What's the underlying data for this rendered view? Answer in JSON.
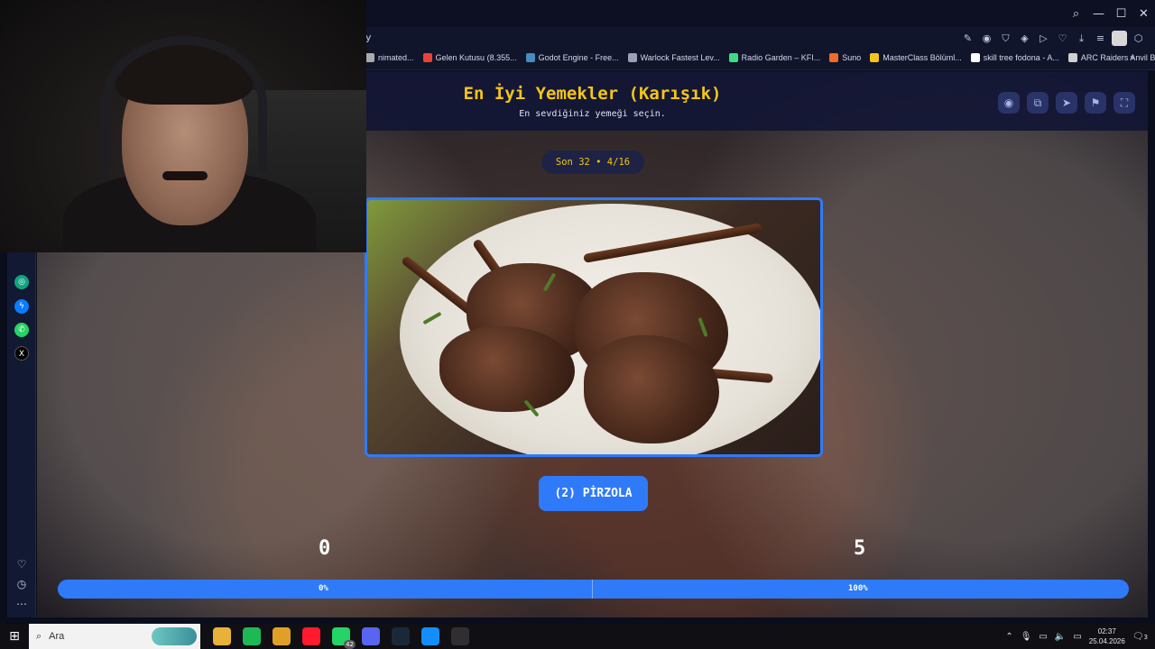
{
  "browser": {
    "url_fragment": "y",
    "window_controls": [
      "search-icon",
      "minimize-icon",
      "maximize-icon",
      "close-icon"
    ],
    "bookmarks": [
      {
        "label": "nimated...",
        "icon": "bookmark-icon",
        "color": "#aaaaaa"
      },
      {
        "label": "Gelen Kutusu (8.355...",
        "icon": "gmail-icon",
        "color": "#ea4335"
      },
      {
        "label": "Godot Engine - Free...",
        "icon": "godot-icon",
        "color": "#478cbf"
      },
      {
        "label": "Warlock Fastest Lev...",
        "icon": "warlock-icon",
        "color": "#9aa0b8"
      },
      {
        "label": "Radio Garden – KFI...",
        "icon": "radio-garden-icon",
        "color": "#3ddc84"
      },
      {
        "label": "Suno",
        "icon": "suno-icon",
        "color": "#f06a2a"
      },
      {
        "label": "MasterClass Bölüml...",
        "icon": "masterclass-icon",
        "color": "#f5c518"
      },
      {
        "label": "skill tree fodona - A...",
        "icon": "doc-icon",
        "color": "#ffffff"
      },
      {
        "label": "ARC Raiders Anvil Bl...",
        "icon": "arc-raiders-icon",
        "color": "#d0d0d0"
      }
    ],
    "bookmarks_more": "»"
  },
  "page": {
    "title": "En İyi Yemekler (Karışık)",
    "subtitle": "En sevdiğiniz yemeği seçin.",
    "header_buttons": [
      "eye-icon",
      "copy-icon",
      "send-icon",
      "flag-icon",
      "fullscreen-icon"
    ],
    "round_label": "Son 32 • 4/16",
    "option_label": "(2) PİRZOLA",
    "score_left": "0",
    "score_right": "5",
    "progress_left_label": "0%",
    "progress_right_label": "100%",
    "progress_fraction": 1.0,
    "accent_color": "#2f7af8",
    "title_color": "#f5c518"
  },
  "taskbar": {
    "search_placeholder": "Ara",
    "apps": [
      {
        "name": "file-explorer-icon",
        "color": "#e8b13a"
      },
      {
        "name": "spotify-icon",
        "color": "#1db954"
      },
      {
        "name": "chrome-icon",
        "color": "#e0a028"
      },
      {
        "name": "opera-icon",
        "color": "#ff1b2d"
      },
      {
        "name": "whatsapp-icon",
        "color": "#25d366",
        "badge": "42"
      },
      {
        "name": "discord-icon",
        "color": "#5865f2"
      },
      {
        "name": "steam-icon",
        "color": "#1b2838"
      },
      {
        "name": "battlenet-icon",
        "color": "#148eff"
      },
      {
        "name": "obs-icon",
        "color": "#302e31"
      }
    ],
    "time": "02:37",
    "date": "25.04.2026",
    "notification_count": "3"
  }
}
